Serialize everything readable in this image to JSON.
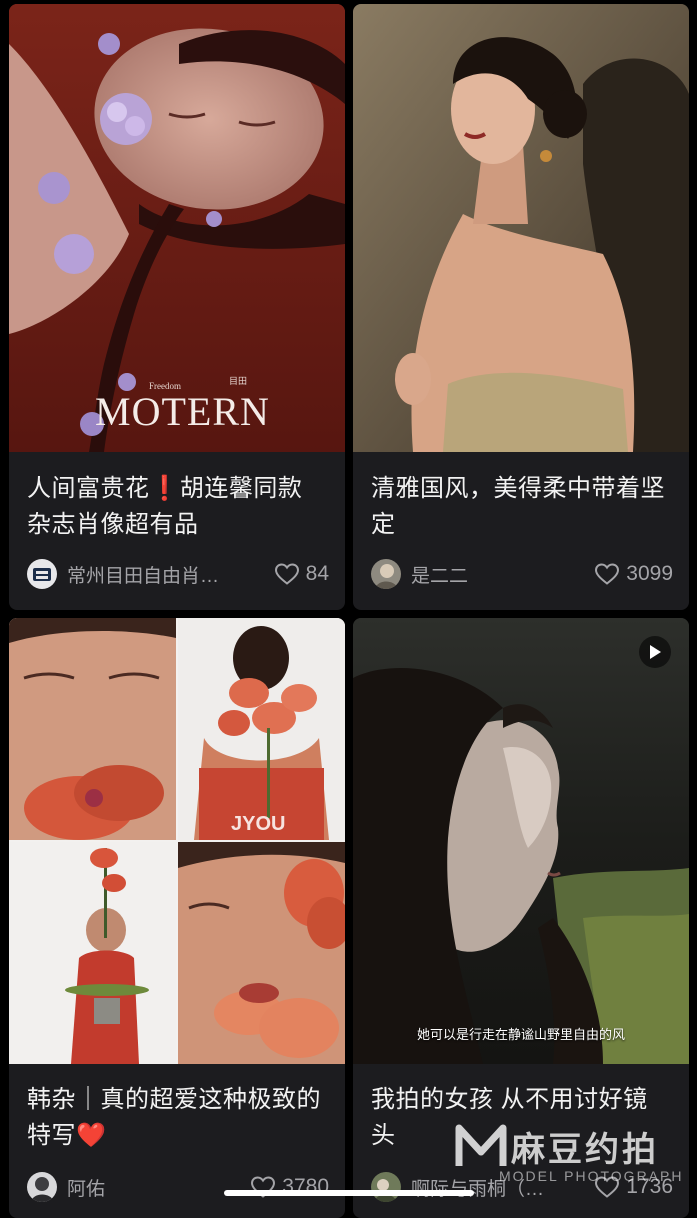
{
  "feed": [
    {
      "title": "人间富贵花❗胡连馨同款杂志肖像超有品",
      "author": "常州目田自由肖…",
      "likes": "84",
      "cover_text": {
        "magazine": "MOTERN",
        "sub": "Freedom",
        "corner": "目田"
      }
    },
    {
      "title": "清雅国风，美得柔中带着坚定",
      "author": "是二二",
      "likes": "3099"
    },
    {
      "title": "韩杂｜真的超爱这种极致的特写❤️",
      "author": "阿佑",
      "likes": "3780",
      "cover_text": {
        "watermark": "JYOU"
      }
    },
    {
      "title": "我拍的女孩 从不用讨好镜头",
      "author": "啊际与雨桐（…",
      "likes": "1736",
      "caption": "她可以是行走在静谧山野里自由的风",
      "is_video": true
    }
  ],
  "watermark": {
    "brand": "麻豆约拍",
    "sub": "MODEL PHOTOGRAPH"
  },
  "icons": {
    "like": "heart-outline-icon",
    "play": "play-icon",
    "logo": "m-logo-icon"
  },
  "colors": {
    "background": "#000000",
    "card": "#1c1c1f",
    "title": "#f2f2f2",
    "meta": "#a4a4a8"
  }
}
